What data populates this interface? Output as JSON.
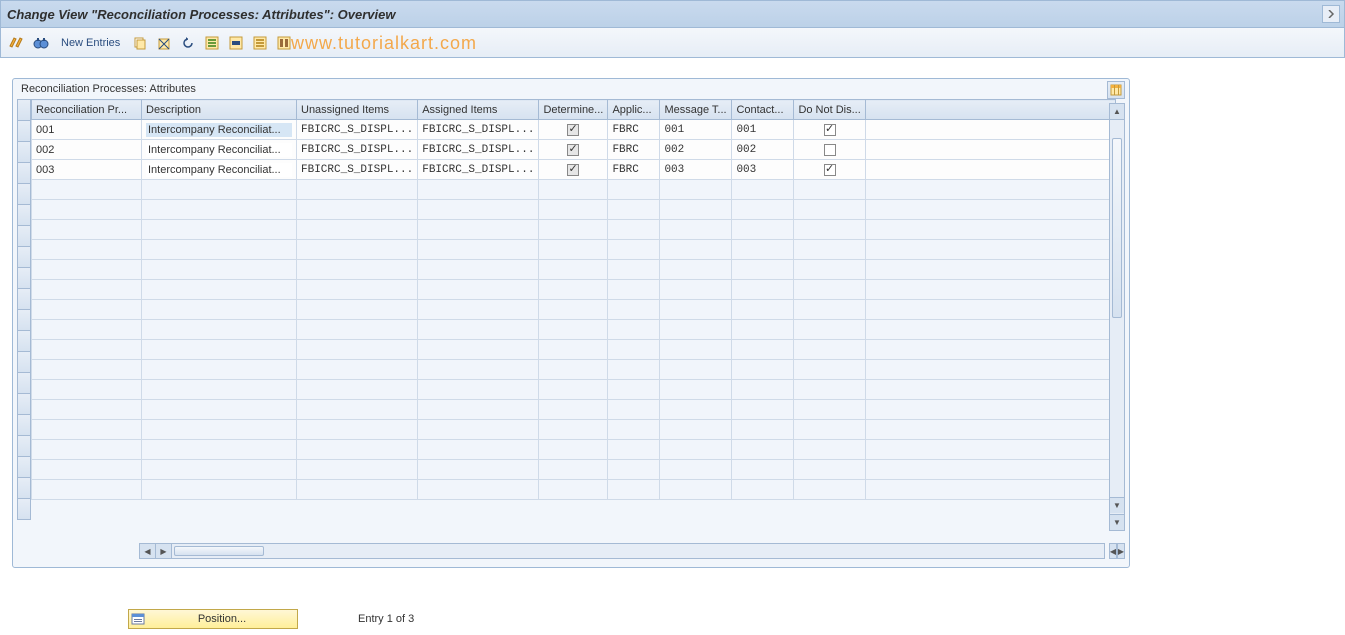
{
  "title": "Change View \"Reconciliation Processes: Attributes\": Overview",
  "toolbar": {
    "new_entries": "New Entries"
  },
  "watermark": "www.tutorialkart.com",
  "group_title": "Reconciliation Processes: Attributes",
  "columns": {
    "recon_process": "Reconciliation Pr...",
    "description": "Description",
    "unassigned": "Unassigned Items",
    "assigned": "Assigned Items",
    "determine": "Determine...",
    "applic": "Applic...",
    "message_t": "Message T...",
    "contact": "Contact...",
    "do_not_dis": "Do Not Dis..."
  },
  "rows": [
    {
      "proc": "001",
      "desc": "Intercompany Reconciliat...",
      "unassigned": "FBICRC_S_DISPL...",
      "assigned": "FBICRC_S_DISPL...",
      "det": true,
      "app": "FBRC",
      "msg": "001",
      "contact": "001",
      "dnd": true
    },
    {
      "proc": "002",
      "desc": "Intercompany Reconciliat...",
      "unassigned": "FBICRC_S_DISPL...",
      "assigned": "FBICRC_S_DISPL...",
      "det": true,
      "app": "FBRC",
      "msg": "002",
      "contact": "002",
      "dnd": false
    },
    {
      "proc": "003",
      "desc": "Intercompany Reconciliat...",
      "unassigned": "FBICRC_S_DISPL...",
      "assigned": "FBICRC_S_DISPL...",
      "det": true,
      "app": "FBRC",
      "msg": "003",
      "contact": "003",
      "dnd": true
    }
  ],
  "empty_row_count": 16,
  "footer": {
    "position_label": "Position...",
    "entry_label": "Entry 1 of 3"
  }
}
